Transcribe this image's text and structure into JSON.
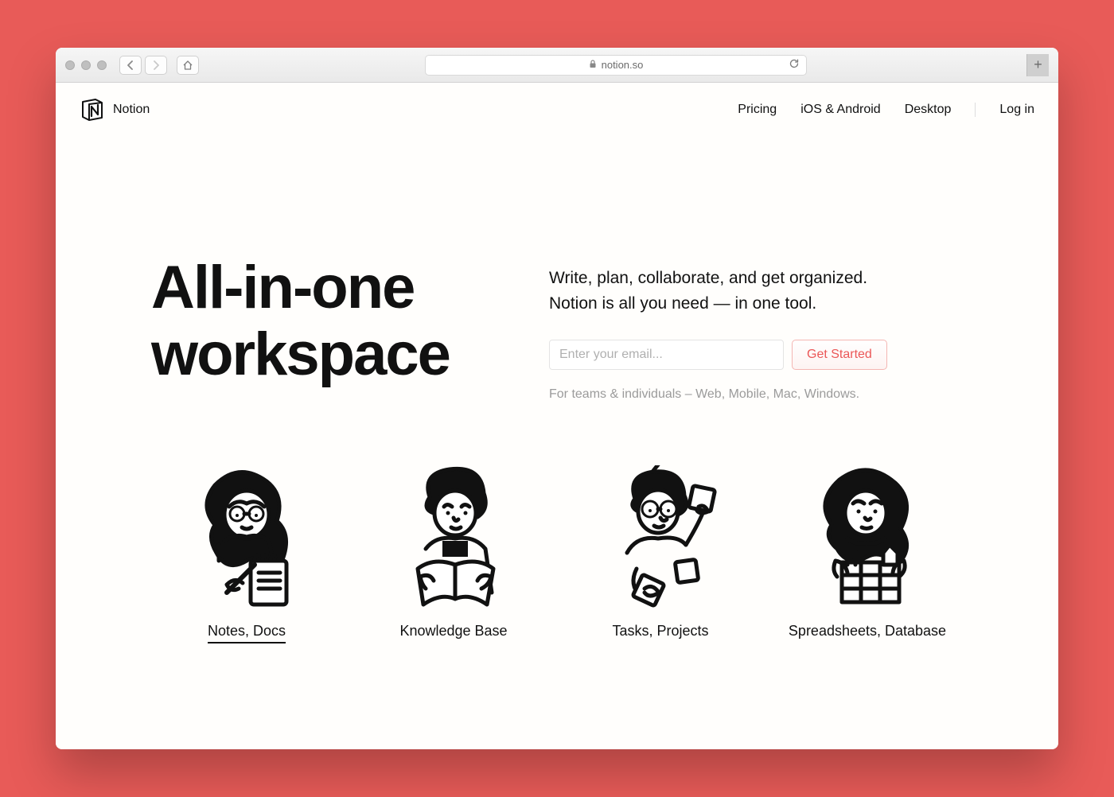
{
  "browser": {
    "url_host": "notion.so"
  },
  "header": {
    "brand": "Notion",
    "nav": {
      "pricing": "Pricing",
      "mobile": "iOS & Android",
      "desktop": "Desktop",
      "login": "Log in"
    }
  },
  "hero": {
    "title_line1": "All-in-one",
    "title_line2": "workspace",
    "subtitle_line1": "Write, plan, collaborate, and get organized.",
    "subtitle_line2": "Notion is all you need — in one tool.",
    "email_placeholder": "Enter your email...",
    "cta_label": "Get Started",
    "meta": "For teams & individuals – Web, Mobile, Mac, Windows."
  },
  "features": [
    {
      "label": "Notes, Docs",
      "active": true
    },
    {
      "label": "Knowledge Base",
      "active": false
    },
    {
      "label": "Tasks, Projects",
      "active": false
    },
    {
      "label": "Spreadsheets, Database",
      "active": false
    }
  ]
}
